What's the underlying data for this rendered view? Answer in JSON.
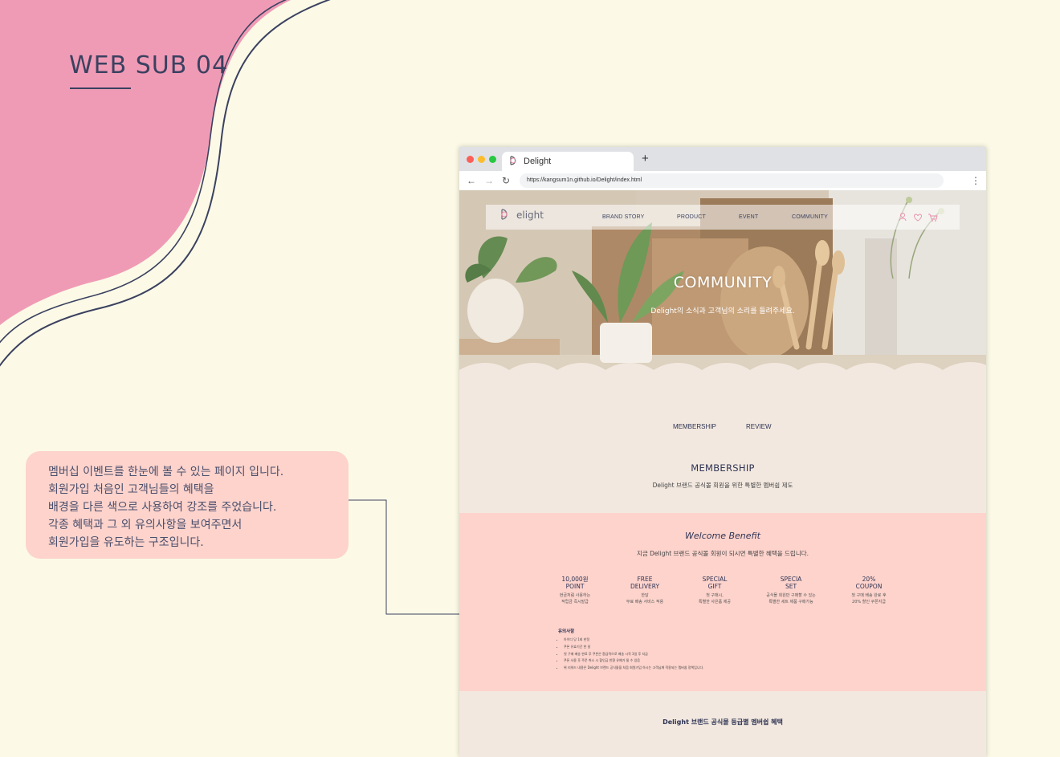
{
  "page": {
    "title": "WEB SUB 04"
  },
  "description": {
    "lines": [
      "멤버십 이벤트를 한눈에 볼 수 있는 페이지 입니다.",
      "회원가입 처음인 고객님들의 혜택을",
      "배경을 다른 색으로 사용하여 강조를 주었습니다.",
      "각종 혜택과 그 외 유의사항을 보여주면서",
      "회원가입을 유도하는 구조입니다."
    ]
  },
  "browser": {
    "tab_title": "Delight",
    "new_tab_symbol": "+",
    "url": "https://kangsum1n.github.io/Delight/index.html",
    "icons": [
      "back-arrow-icon",
      "forward-arrow-icon",
      "reload-icon",
      "more-menu-icon"
    ]
  },
  "site": {
    "logo_text": "elight",
    "nav": [
      "BRAND STORY",
      "PRODUCT",
      "EVENT",
      "COMMUNITY"
    ],
    "nav_icons": [
      "user-icon",
      "heart-icon",
      "cart-icon"
    ],
    "hero_title": "COMMUNITY",
    "hero_subtitle": "Delight의 소식과 고객님의 소리를 들려주세요.",
    "subtabs": [
      "MEMBERSHIP",
      "REVIEW"
    ],
    "section_title": "MEMBERSHIP",
    "section_subtitle": "Delight 브랜드 공식몰 회원을 위한 특별한 멤버쉽 제도",
    "benefit": {
      "title": "Welcome Benefit",
      "subtitle": "지금 Delight 브랜드 공식몰 회원이 되시면 특별한 혜택을 드립니다.",
      "items": [
        {
          "head1": "10,000원",
          "head2": "POINT",
          "desc1": "현금처럼 사용하는",
          "desc2": "적립금 즉시발급"
        },
        {
          "head1": "FREE",
          "head2": "DELIVERY",
          "desc1": "한달",
          "desc2": "무료 배송 서비스 적용"
        },
        {
          "head1": "SPECIAL",
          "head2": "GIFT",
          "desc1": "첫 구매시,",
          "desc2": "특별한 사은품 제공"
        },
        {
          "head1": "SPECIA",
          "head2": "SET",
          "desc1": "공식몰 회원만 구매할 수 있는",
          "desc2": "특별한 세트 제품 구매가능"
        },
        {
          "head1": "20%",
          "head2": "COUPON",
          "desc1": "첫 구매 배송 완료 후",
          "desc2": "20% 할인 쿠폰지급"
        }
      ],
      "notice_title": "유의사항",
      "notices": [
        "아이디 당 1회 한정",
        "쿠폰 유효기간 한 달",
        "첫 구매 배송 완료 후 쿠폰은 환급적으로 배송 시작 3일 후 지급",
        "쿠폰 사용 후 주문 취소 시 할인금 반환 유예가 될 수 있음",
        "위 리워드 내용은 Delight 브랜드 공식몰을 처음 회원가입 하시는 고객님께 적용되는 멤버쉽 정책입니다."
      ]
    },
    "grade_title": "Delight 브랜드 공식몰 등급별 멤버쉽 혜택"
  },
  "colors": {
    "background": "#fcfae6",
    "pink_blob": "#f09bb6",
    "accent_navy": "#3b4160",
    "note_box": "#fdd3cc",
    "benefit_band": "#fdd3cc",
    "page_beige": "#f2e8df"
  }
}
